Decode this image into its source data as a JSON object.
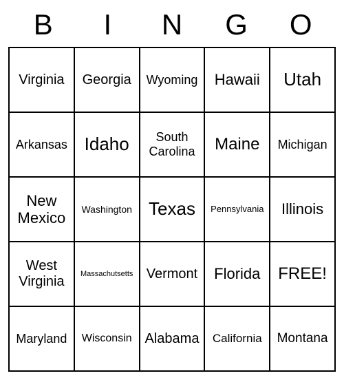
{
  "header": [
    "B",
    "I",
    "N",
    "G",
    "O"
  ],
  "grid": [
    [
      {
        "text": "Virginia",
        "size": 20
      },
      {
        "text": "Georgia",
        "size": 20
      },
      {
        "text": "Wyoming",
        "size": 18
      },
      {
        "text": "Hawaii",
        "size": 22
      },
      {
        "text": "Utah",
        "size": 26
      }
    ],
    [
      {
        "text": "Arkansas",
        "size": 18
      },
      {
        "text": "Idaho",
        "size": 26
      },
      {
        "text": "South Carolina",
        "size": 18
      },
      {
        "text": "Maine",
        "size": 24
      },
      {
        "text": "Michigan",
        "size": 18
      }
    ],
    [
      {
        "text": "New Mexico",
        "size": 22
      },
      {
        "text": "Washington",
        "size": 14
      },
      {
        "text": "Texas",
        "size": 26
      },
      {
        "text": "Pennsylvania",
        "size": 13
      },
      {
        "text": "Illinois",
        "size": 22
      }
    ],
    [
      {
        "text": "West Virginia",
        "size": 20
      },
      {
        "text": "Massachutsetts",
        "size": 11
      },
      {
        "text": "Vermont",
        "size": 20
      },
      {
        "text": "Florida",
        "size": 22
      },
      {
        "text": "FREE!",
        "size": 24
      }
    ],
    [
      {
        "text": "Maryland",
        "size": 18
      },
      {
        "text": "Wisconsin",
        "size": 16
      },
      {
        "text": "Alabama",
        "size": 20
      },
      {
        "text": "California",
        "size": 17
      },
      {
        "text": "Montana",
        "size": 19
      }
    ]
  ]
}
